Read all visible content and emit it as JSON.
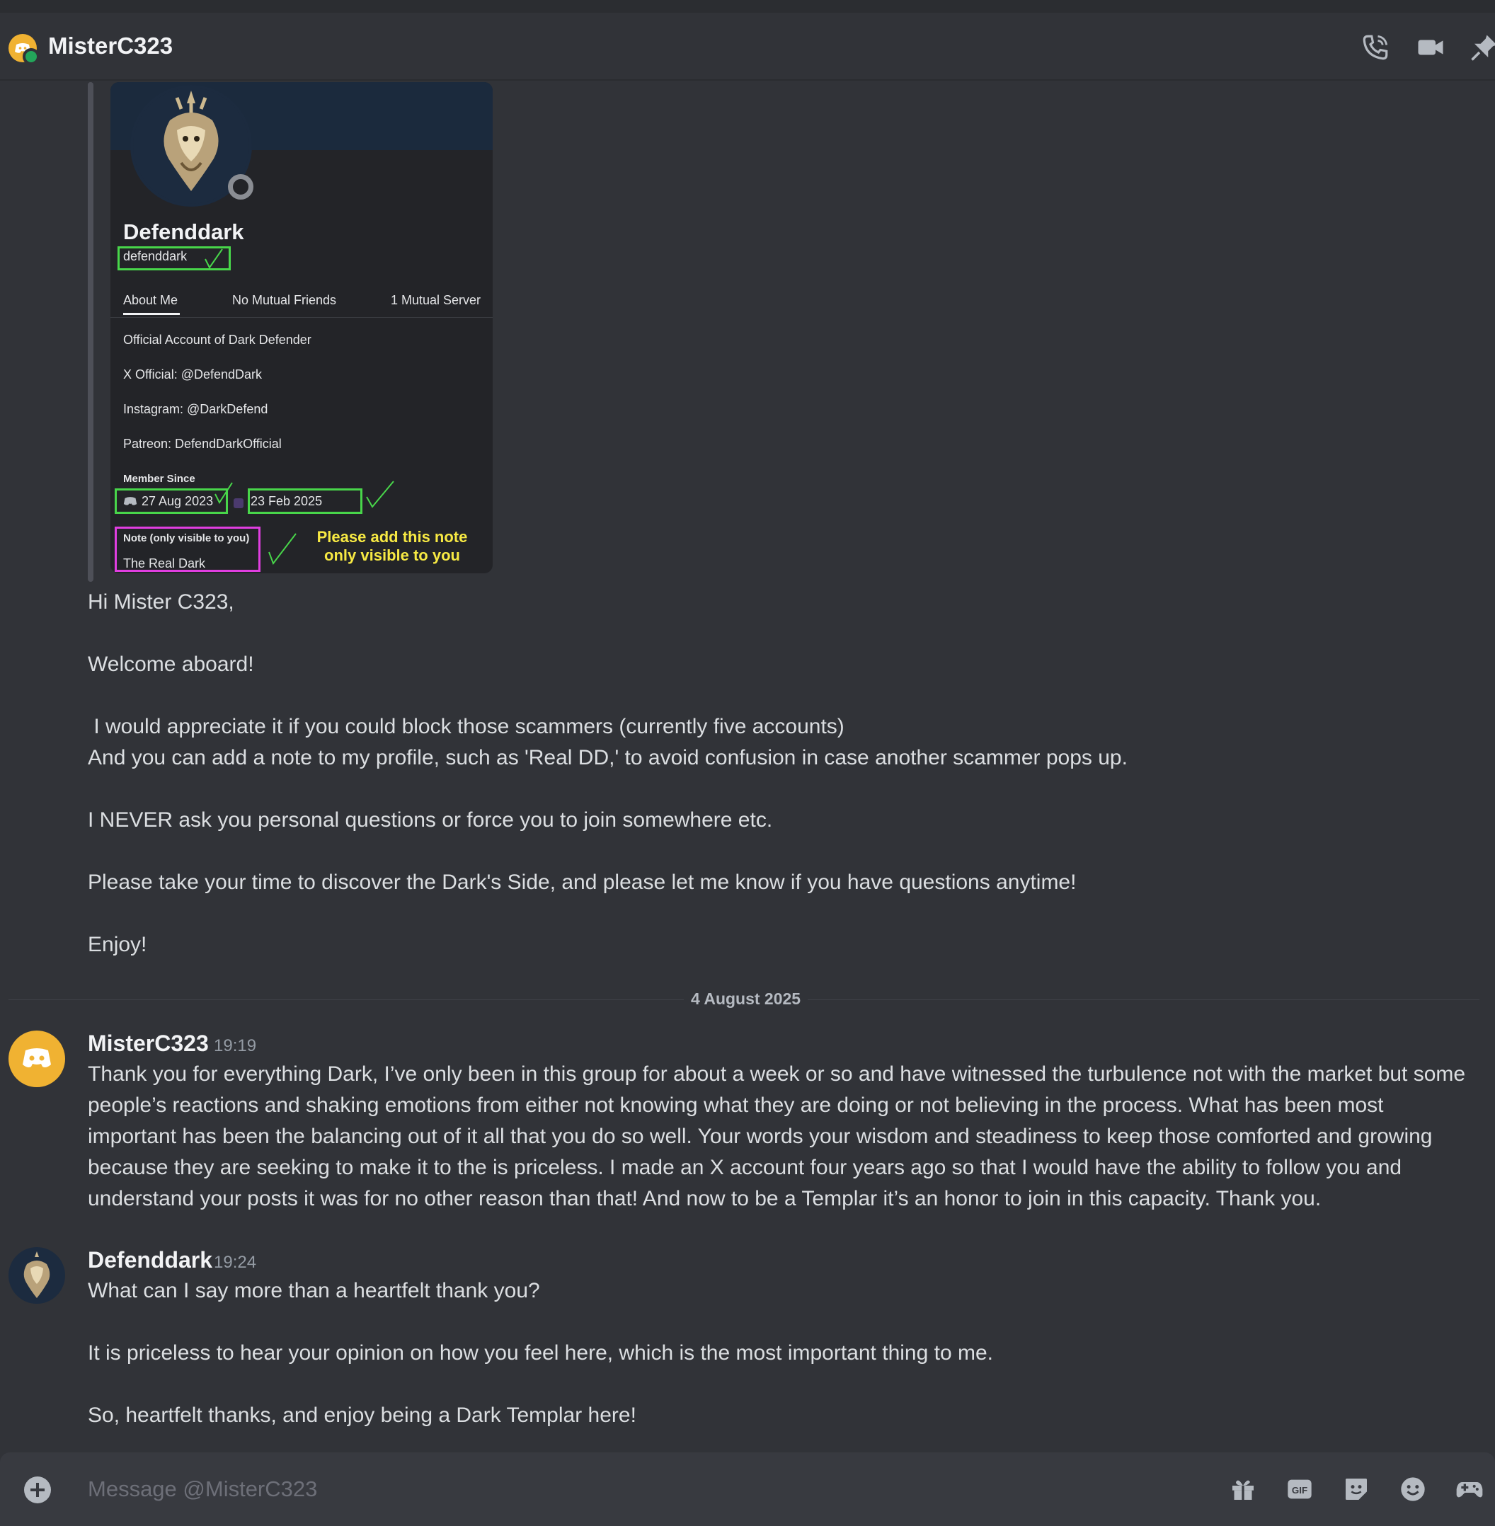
{
  "header": {
    "title": "MisterC323"
  },
  "profile_card": {
    "display_name": "Defenddark",
    "username": "defenddark",
    "tabs": [
      "About Me",
      "No Mutual Friends",
      "1 Mutual Server"
    ],
    "about": [
      "Official Account of Dark Defender",
      "X Official: @DefendDark",
      "Instagram: @DarkDefend",
      "Patreon: DefendDarkOfficial"
    ],
    "member_since_label": "Member Since",
    "discord_since": "27 Aug 2023",
    "server_since": "23 Feb 2025",
    "note_label": "Note (only visible to you)",
    "note_value": "The Real Dark",
    "annotation": "Please add this note only visible to you"
  },
  "first_message": {
    "lines": [
      "Hi Mister C323,",
      "Welcome aboard!",
      " I would appreciate it if you could block those scammers (currently five accounts)",
      "And you can add a note to my profile, such as 'Real DD,' to avoid confusion in case another scammer pops up.",
      "I NEVER ask you personal questions or force you to join somewhere etc.",
      "Please take your time to discover the Dark's Side, and please let me know if you have questions anytime!",
      "Enjoy!"
    ]
  },
  "date_divider": "4 August 2025",
  "messages": [
    {
      "author": "MisterC323",
      "time": "19:19",
      "text": "Thank you for everything Dark, I’ve only been in this group for about a week or so and have witnessed the turbulence not with the market but some people’s reactions and shaking emotions from either not knowing what they are doing or not believing in the process. What has been most important has been the balancing out of it all that you do so well. Your words your wisdom and steadiness to keep those comforted and growing because they are seeking to make it to the is priceless. I made an X account four years ago so that I would have the ability to follow you and understand your posts it was for no other reason than that! And now to be a Templar it’s an honor to join in this capacity. Thank you."
    },
    {
      "author": "Defenddark",
      "time": "19:24",
      "paragraphs": [
        "What can I say more than a heartfelt thank you?",
        "It is priceless to hear your opinion on how you feel here, which is the most important thing to me.",
        "So, heartfelt thanks, and enjoy being a Dark Templar here!"
      ]
    }
  ],
  "composer": {
    "placeholder": "Message @MisterC323",
    "gif_label": "GIF"
  },
  "colors": {
    "background": "#313338",
    "accent_orange": "#f0b232",
    "online_green": "#23a55a",
    "highlight_green": "#48d64a",
    "highlight_magenta": "#e03ee0",
    "annotation_yellow": "#f7e943"
  },
  "icons": [
    "phone-icon",
    "video-icon",
    "pin-icon",
    "plus-icon",
    "gift-icon",
    "gif-icon",
    "sticker-icon",
    "emoji-icon",
    "game-controller-icon"
  ]
}
